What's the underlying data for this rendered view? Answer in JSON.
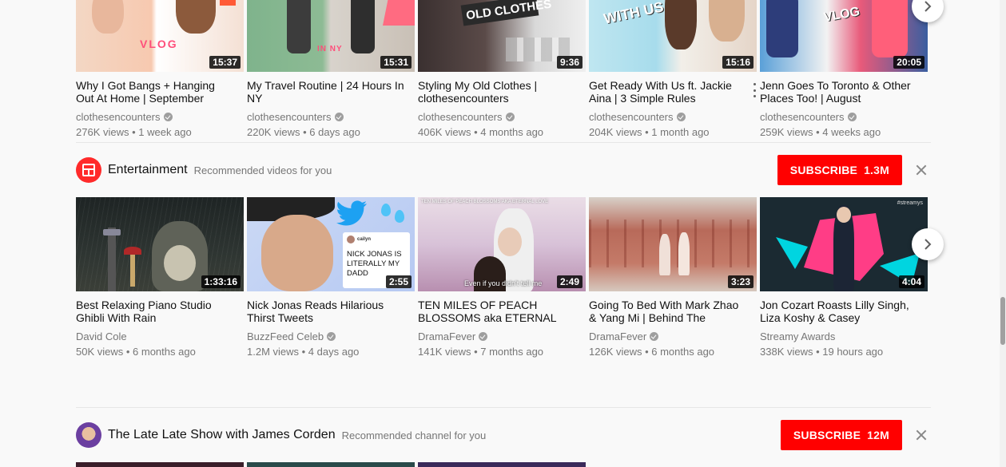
{
  "top_row": [
    {
      "title": "Why I Got Bangs + Hanging Out At Home | September",
      "channel": "clothesencounters",
      "verified": true,
      "meta": "276K views • 1 week ago",
      "duration": "15:37",
      "overlay": "VLOG"
    },
    {
      "title": "My Travel Routine | 24 Hours In NY",
      "channel": "clothesencounters",
      "verified": true,
      "meta": "220K views • 6 days ago",
      "duration": "15:31",
      "overlay": "IN NY"
    },
    {
      "title": "Styling My Old Clothes | clothesencounters",
      "channel": "clothesencounters",
      "verified": true,
      "meta": "406K views • 4 months ago",
      "duration": "9:36",
      "overlay": "OLD CLOTHES"
    },
    {
      "title": "Get Ready With Us ft. Jackie Aina | 3 Simple Rules",
      "channel": "clothesencounters",
      "verified": true,
      "meta": "204K views • 1 month ago",
      "duration": "15:16",
      "overlay": "WITH US"
    },
    {
      "title": "Jenn Goes To Toronto & Other Places Too! | August",
      "channel": "clothesencounters",
      "verified": true,
      "meta": "259K views • 4 weeks ago",
      "duration": "20:05",
      "overlay": "VLOG"
    }
  ],
  "entertainment": {
    "title": "Entertainment",
    "subtitle": "Recommended videos for you",
    "subscribe_label": "SUBSCRIBE",
    "subscriber_count": "1.3M",
    "videos": [
      {
        "title": "Best Relaxing Piano Studio Ghibli With Rain",
        "channel": "David Cole",
        "verified": false,
        "meta": "50K views • 6 months ago",
        "duration": "1:33:16"
      },
      {
        "title": "Nick Jonas Reads Hilarious Thirst Tweets",
        "channel": "BuzzFeed Celeb",
        "verified": true,
        "meta": "1.2M views • 4 days ago",
        "duration": "2:55",
        "tweet_text": "NICK JONAS IS LITERALLY MY DADD",
        "tweet_user": "cailyn"
      },
      {
        "title": "TEN MILES OF PEACH BLOSSOMS aka ETERNAL",
        "channel": "DramaFever",
        "verified": true,
        "meta": "141K views • 7 months ago",
        "duration": "2:49",
        "caption": "Even if you didn't tell me",
        "banner": "TEN MILES OF PEACH BLOSSOMS AKA ETERNAL LOVE"
      },
      {
        "title": "Going To Bed With Mark Zhao & Yang Mi | Behind The",
        "channel": "DramaFever",
        "verified": true,
        "meta": "126K views • 6 months ago",
        "duration": "3:23"
      },
      {
        "title": "Jon Cozart Roasts Lilly Singh, Liza Koshy & Casey",
        "channel": "Streamy Awards",
        "verified": false,
        "meta": "338K views • 19 hours ago",
        "duration": "4:04",
        "tag": "#streamys"
      }
    ]
  },
  "late_late": {
    "title": "The Late Late Show with James Corden",
    "subtitle": "Recommended channel for you",
    "subscribe_label": "SUBSCRIBE",
    "subscriber_count": "12M"
  },
  "colors": {
    "subscribe": "#ff0000",
    "background": "#f9f9f9",
    "secondary_text": "#767676"
  }
}
